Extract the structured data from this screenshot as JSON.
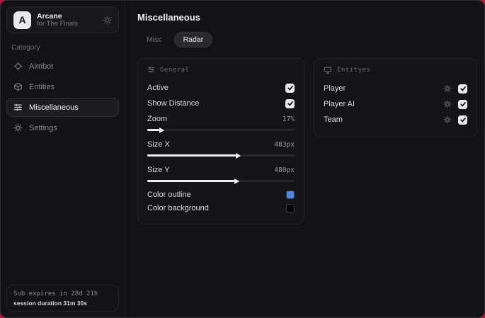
{
  "app": {
    "name": "Arcane",
    "subtitle": "for The Finals",
    "logo_letter": "A"
  },
  "sidebar": {
    "category_label": "Category",
    "items": [
      {
        "label": "Aimbot",
        "icon": "crosshair-icon"
      },
      {
        "label": "Entities",
        "icon": "cube-icon"
      },
      {
        "label": "Miscellaneous",
        "icon": "sliders-icon"
      },
      {
        "label": "Settings",
        "icon": "gear-icon"
      }
    ],
    "active_item": "Miscellaneous",
    "sub_status": {
      "expires": "Sub expires in 28d 21h",
      "session": "session duration 31m 30s"
    }
  },
  "main": {
    "title": "Miscellaneous",
    "tabs": [
      {
        "label": "Misc",
        "active": false
      },
      {
        "label": "Radar",
        "active": true
      }
    ]
  },
  "general_panel": {
    "title": "General",
    "icon": "sliders-icon",
    "toggles": [
      {
        "label": "Active",
        "checked": true
      },
      {
        "label": "Show Distance",
        "checked": true
      }
    ],
    "sliders": [
      {
        "label": "Zoom",
        "value": "17%",
        "fill_pct": 8
      },
      {
        "label": "Size X",
        "value": "483px",
        "fill_pct": 60
      },
      {
        "label": "Size Y",
        "value": "480px",
        "fill_pct": 59
      }
    ],
    "color_rows": [
      {
        "label": "Color outline",
        "swatch": "#4b87e2"
      },
      {
        "label": "Color background",
        "swatch": "#060606"
      }
    ]
  },
  "entities_panel": {
    "title": "Entityes",
    "icon": "monitor-icon",
    "rows": [
      {
        "label": "Player",
        "checked": true
      },
      {
        "label": "Player AI",
        "checked": true
      },
      {
        "label": "Team",
        "checked": true
      }
    ]
  },
  "theme": {
    "backdrop": "#b5173c",
    "window_bg": "#131315",
    "panel_bg": "#151518",
    "accent_blue": "#4b87e2",
    "checkbox_bg": "#e9e9eb"
  }
}
